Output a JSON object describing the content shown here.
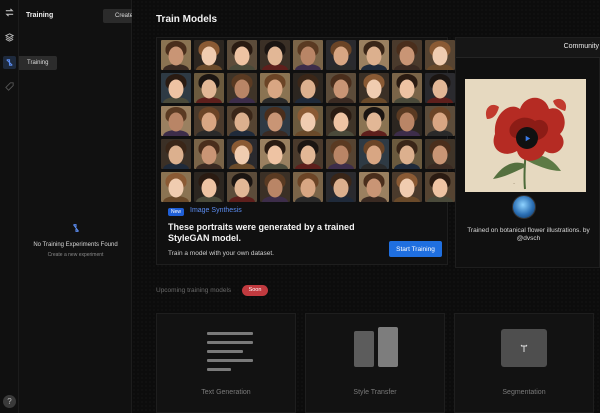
{
  "sidebar": {
    "title": "Training",
    "create_label": "Create",
    "active_item": "Training",
    "empty_title": "No Training Experiments Found",
    "empty_subtitle": "Create a new experiment",
    "rail_icons": [
      "swap-icon",
      "layers-icon",
      "training-icon",
      "tag-icon",
      "help-icon"
    ],
    "help_label": "?"
  },
  "main": {
    "title": "Train Models",
    "hero": {
      "badge": "New",
      "tag": "Image Synthesis",
      "headline": "These portraits were generated by a trained StyleGAN model.",
      "subtext": "Train a model with your own dataset.",
      "cta": "Start Training"
    },
    "community": {
      "tab": "Community",
      "caption": "Trained on botanical flower illustrations. by @dvsch"
    },
    "upcoming": {
      "label": "Upcoming training models",
      "badge": "Soon",
      "cards": [
        {
          "label": "Text Generation"
        },
        {
          "label": "Style Transfer"
        },
        {
          "label": "Segmentation"
        }
      ]
    }
  },
  "colors": {
    "accent": "#1f6fe0",
    "soon_badge": "#c13a3f",
    "link_blue": "#5b8cf0"
  }
}
